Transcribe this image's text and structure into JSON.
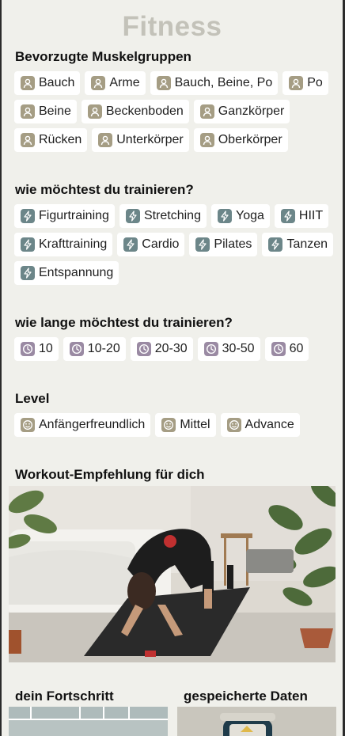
{
  "app": {
    "title": "Fitness"
  },
  "muscles": {
    "title": "Bevorzugte Muskelgruppen",
    "items": [
      "Bauch",
      "Arme",
      "Bauch, Beine, Po",
      "Po",
      "Beine",
      "Beckenboden",
      "Ganzkörper",
      "Rücken",
      "Unterkörper",
      "Oberkörper"
    ],
    "icon": "person-icon"
  },
  "training": {
    "title": "wie möchtest du trainieren?",
    "items": [
      "Figurtraining",
      "Stretching",
      "Yoga",
      "HIIT",
      "Krafttraining",
      "Cardio",
      "Pilates",
      "Tanzen",
      "Entspannung"
    ],
    "icon": "lightning-icon"
  },
  "duration": {
    "title": "wie lange möchtest du trainieren?",
    "items": [
      "10",
      "10-20",
      "20-30",
      "30-50",
      "60"
    ],
    "icon": "clock-icon"
  },
  "level": {
    "title": "Level",
    "items": [
      "Anfängerfreundlich",
      "Mittel",
      "Advance"
    ],
    "icon": "smiley-icon"
  },
  "recommendation": {
    "title": "Workout-Empfehlung für dich",
    "image_icon": "workout-photo"
  },
  "progress": {
    "title": "dein Fortschritt"
  },
  "saved": {
    "title": "gespeicherte Daten"
  },
  "colors": {
    "background": "#f0f0eb",
    "title_color": "#c3c2b9",
    "person_icon": "#a59d84",
    "bolt_icon": "#6c8689",
    "clock_icon": "#9a8aa3"
  }
}
